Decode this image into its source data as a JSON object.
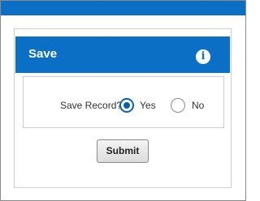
{
  "panel": {
    "title": "Save",
    "info_icon": "info-icon"
  },
  "form": {
    "question": "Save Record?",
    "options": [
      {
        "label": "Yes",
        "selected": true
      },
      {
        "label": "No",
        "selected": false
      }
    ]
  },
  "actions": {
    "submit_label": "Submit"
  },
  "colors": {
    "brand": "#0b6fc6",
    "radio_selected": "#0b5fb0"
  }
}
